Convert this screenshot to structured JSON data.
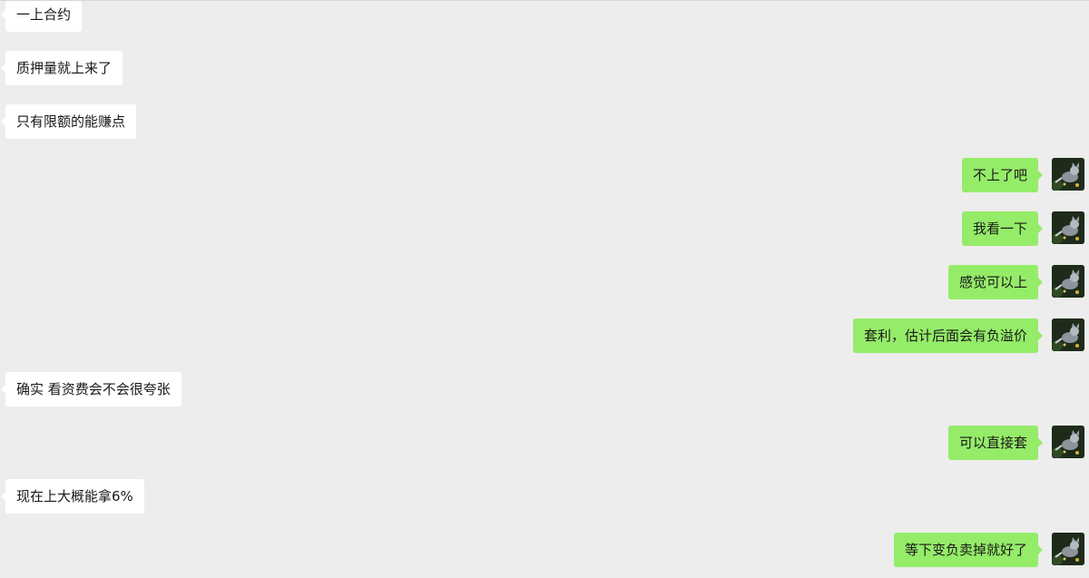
{
  "messages": [
    {
      "side": "left",
      "text": "一上合约"
    },
    {
      "side": "left",
      "text": "质押量就上来了"
    },
    {
      "side": "left",
      "text": "只有限额的能赚点"
    },
    {
      "side": "right",
      "text": "不上了吧",
      "avatar": "cat-avatar-icon"
    },
    {
      "side": "right",
      "text": "我看一下",
      "avatar": "cat-avatar-icon"
    },
    {
      "side": "right",
      "text": "感觉可以上",
      "avatar": "cat-avatar-icon"
    },
    {
      "side": "right",
      "text": "套利，估计后面会有负溢价",
      "avatar": "cat-avatar-icon"
    },
    {
      "side": "left",
      "text": "确实 看资费会不会很夸张"
    },
    {
      "side": "right",
      "text": "可以直接套",
      "avatar": "cat-avatar-icon"
    },
    {
      "side": "left",
      "text": "现在上大概能拿6%"
    },
    {
      "side": "right",
      "text": "等下变负卖掉就好了",
      "avatar": "cat-avatar-icon"
    }
  ],
  "colors": {
    "background": "#ededed",
    "incoming_bubble": "#ffffff",
    "outgoing_bubble": "#95ec69"
  }
}
